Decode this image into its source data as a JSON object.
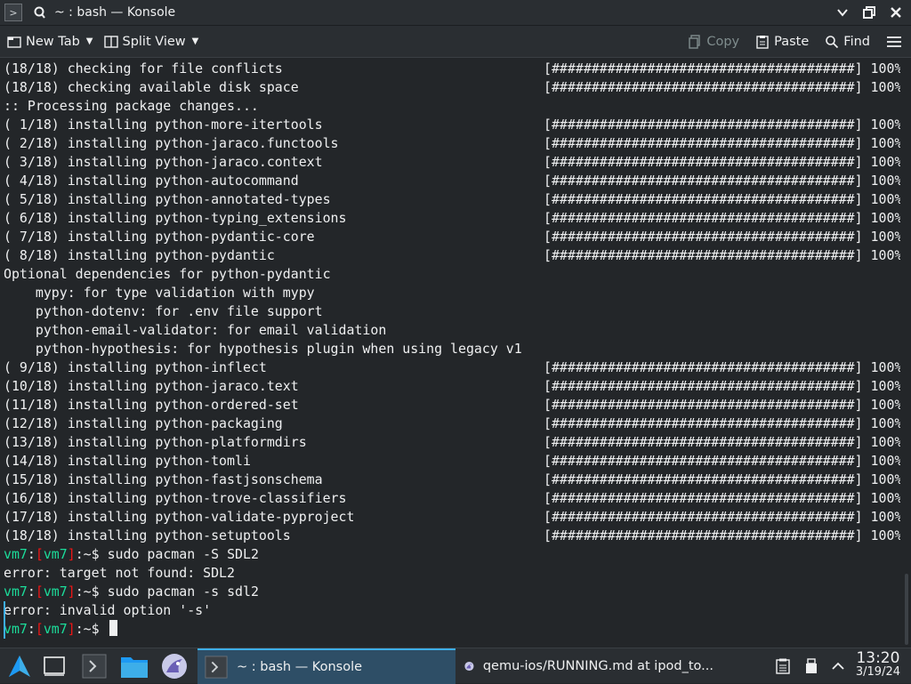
{
  "window": {
    "title": "~ : bash — Konsole"
  },
  "toolbar": {
    "new_tab": "New Tab",
    "split_view": "Split View",
    "copy": "Copy",
    "paste": "Paste",
    "find": "Find"
  },
  "terminal": {
    "lines": [
      {
        "text": "(18/18) checking for file conflicts",
        "bar": "[######################################] 100%"
      },
      {
        "text": "(18/18) checking available disk space",
        "bar": "[######################################] 100%"
      },
      {
        "text": ":: Processing package changes...",
        "bar": ""
      },
      {
        "text": "( 1/18) installing python-more-itertools",
        "bar": "[######################################] 100%"
      },
      {
        "text": "( 2/18) installing python-jaraco.functools",
        "bar": "[######################################] 100%"
      },
      {
        "text": "( 3/18) installing python-jaraco.context",
        "bar": "[######################################] 100%"
      },
      {
        "text": "( 4/18) installing python-autocommand",
        "bar": "[######################################] 100%"
      },
      {
        "text": "( 5/18) installing python-annotated-types",
        "bar": "[######################################] 100%"
      },
      {
        "text": "( 6/18) installing python-typing_extensions",
        "bar": "[######################################] 100%"
      },
      {
        "text": "( 7/18) installing python-pydantic-core",
        "bar": "[######################################] 100%"
      },
      {
        "text": "( 8/18) installing python-pydantic",
        "bar": "[######################################] 100%"
      },
      {
        "text": "Optional dependencies for python-pydantic",
        "bar": ""
      },
      {
        "text": "    mypy: for type validation with mypy",
        "bar": ""
      },
      {
        "text": "    python-dotenv: for .env file support",
        "bar": ""
      },
      {
        "text": "    python-email-validator: for email validation",
        "bar": ""
      },
      {
        "text": "    python-hypothesis: for hypothesis plugin when using legacy v1",
        "bar": ""
      },
      {
        "text": "( 9/18) installing python-inflect",
        "bar": "[######################################] 100%"
      },
      {
        "text": "(10/18) installing python-jaraco.text",
        "bar": "[######################################] 100%"
      },
      {
        "text": "(11/18) installing python-ordered-set",
        "bar": "[######################################] 100%"
      },
      {
        "text": "(12/18) installing python-packaging",
        "bar": "[######################################] 100%"
      },
      {
        "text": "(13/18) installing python-platformdirs",
        "bar": "[######################################] 100%"
      },
      {
        "text": "(14/18) installing python-tomli",
        "bar": "[######################################] 100%"
      },
      {
        "text": "(15/18) installing python-fastjsonschema",
        "bar": "[######################################] 100%"
      },
      {
        "text": "(16/18) installing python-trove-classifiers",
        "bar": "[######################################] 100%"
      },
      {
        "text": "(17/18) installing python-validate-pyproject",
        "bar": "[######################################] 100%"
      },
      {
        "text": "(18/18) installing python-setuptools",
        "bar": "[######################################] 100%"
      }
    ],
    "prompt": {
      "host": "vm7",
      "colon": ":",
      "lbracket": "[",
      "host2": "vm7",
      "rbracket": "]",
      "path": ":~$"
    },
    "cmd1": " sudo pacman -S SDL2",
    "out1": "error: target not found: SDL2",
    "cmd2": " sudo pacman -s sdl2",
    "out2": "error: invalid option '-s'",
    "cmd3": " "
  },
  "taskbar": {
    "tasks": [
      {
        "label": "~ : bash — Konsole"
      },
      {
        "label": "qemu-ios/RUNNING.md at ipod_to..."
      }
    ],
    "clock_time": "13:20",
    "clock_date": "3/19/24"
  },
  "colors": {
    "prompt_green": "#1cdc9a",
    "prompt_red": "#ed1515",
    "accent": "#3daee9"
  }
}
